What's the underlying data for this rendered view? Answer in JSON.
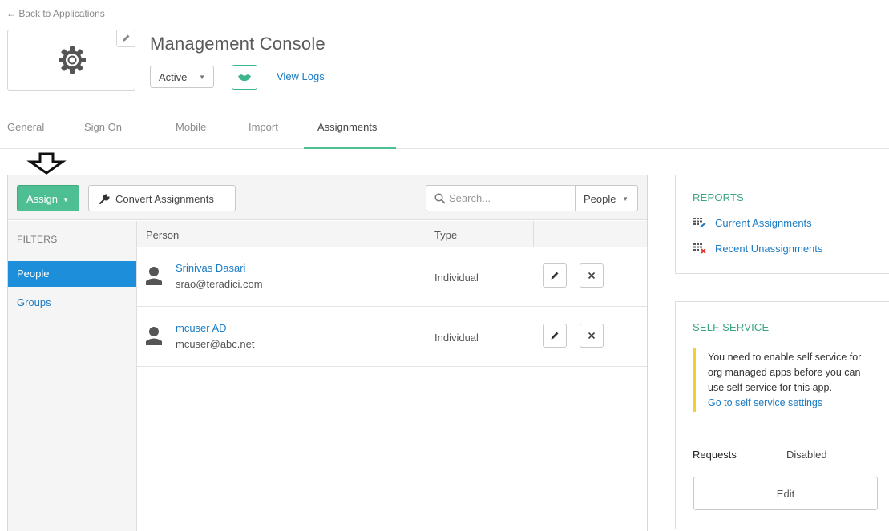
{
  "back_link": "← Back to Applications",
  "app": {
    "title": "Management Console",
    "status": "Active",
    "view_logs": "View Logs"
  },
  "tabs": [
    {
      "label": "General"
    },
    {
      "label": "Sign On"
    },
    {
      "label": "Mobile"
    },
    {
      "label": "Import"
    },
    {
      "label": "Assignments",
      "active": true
    }
  ],
  "toolbar": {
    "assign_label": "Assign",
    "convert_label": "Convert Assignments",
    "search_placeholder": "Search...",
    "search_type": "People"
  },
  "filters": {
    "label": "FILTERS",
    "items": [
      {
        "label": "People",
        "active": true
      },
      {
        "label": "Groups",
        "active": false
      }
    ]
  },
  "table": {
    "headers": [
      "Person",
      "Type"
    ],
    "rows": [
      {
        "name": "Srinivas Dasari",
        "email": "srao@teradici.com",
        "type": "Individual"
      },
      {
        "name": "mcuser AD",
        "email": "mcuser@abc.net",
        "type": "Individual"
      }
    ]
  },
  "reports": {
    "heading": "REPORTS",
    "links": [
      "Current Assignments",
      "Recent Unassignments"
    ]
  },
  "self_service": {
    "heading": "SELF SERVICE",
    "notice": "You need to enable self service for org managed apps before you can use self service for this app.",
    "notice_link": "Go to self service settings",
    "requests_label": "Requests",
    "requests_value": "Disabled",
    "edit_label": "Edit"
  },
  "colors": {
    "accent_green": "#4dbf93",
    "link_blue": "#1c7cc4",
    "active_filter": "#1d8ed9",
    "notice_yellow": "#f3d02e"
  }
}
